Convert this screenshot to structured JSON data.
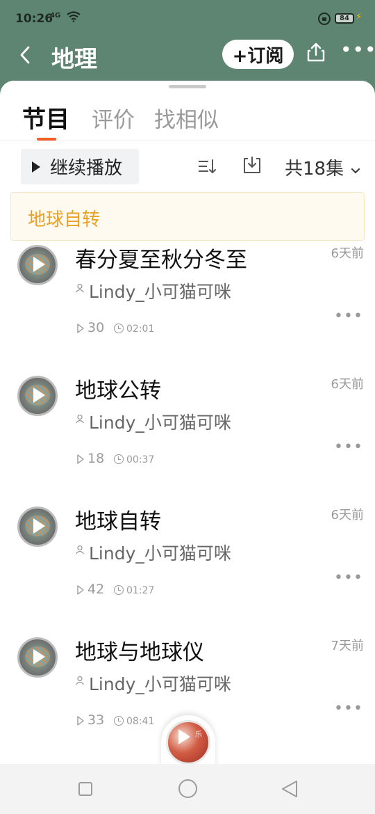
{
  "status_bar": {
    "time": "10:26",
    "signal": "4G",
    "battery": "84"
  },
  "nav": {
    "title": "地理",
    "subscribe_label": "+订阅"
  },
  "tabs": [
    {
      "label": "节目",
      "active": true
    },
    {
      "label": "评价",
      "active": false
    },
    {
      "label": "找相似",
      "active": false
    }
  ],
  "toolbar": {
    "continue_label": "继续播放",
    "episode_count": "共18集"
  },
  "banner": {
    "text": "地球自转"
  },
  "episodes": [
    {
      "title": "春分夏至秋分冬至",
      "date": "6天前",
      "author": "Lindy_小可猫可咪",
      "plays": "30",
      "duration": "02:01"
    },
    {
      "title": "地球公转",
      "date": "6天前",
      "author": "Lindy_小可猫可咪",
      "plays": "18",
      "duration": "00:37"
    },
    {
      "title": "地球自转",
      "date": "6天前",
      "author": "Lindy_小可猫可咪",
      "plays": "42",
      "duration": "01:27"
    },
    {
      "title": "地球与地球仪",
      "date": "7天前",
      "author": "Lindy_小可猫可咪",
      "plays": "33",
      "duration": "08:41"
    }
  ],
  "mini_player": {
    "glyph": "乐"
  },
  "colors": {
    "header_bg": "#5e8572",
    "accent": "#f25c26",
    "banner_text": "#eaa026"
  },
  "icons": [
    "back-icon",
    "share-icon",
    "more-icon",
    "sort-icon",
    "download-icon",
    "chevron-down-icon",
    "play-icon",
    "user-icon",
    "play-count-icon",
    "clock-icon"
  ]
}
